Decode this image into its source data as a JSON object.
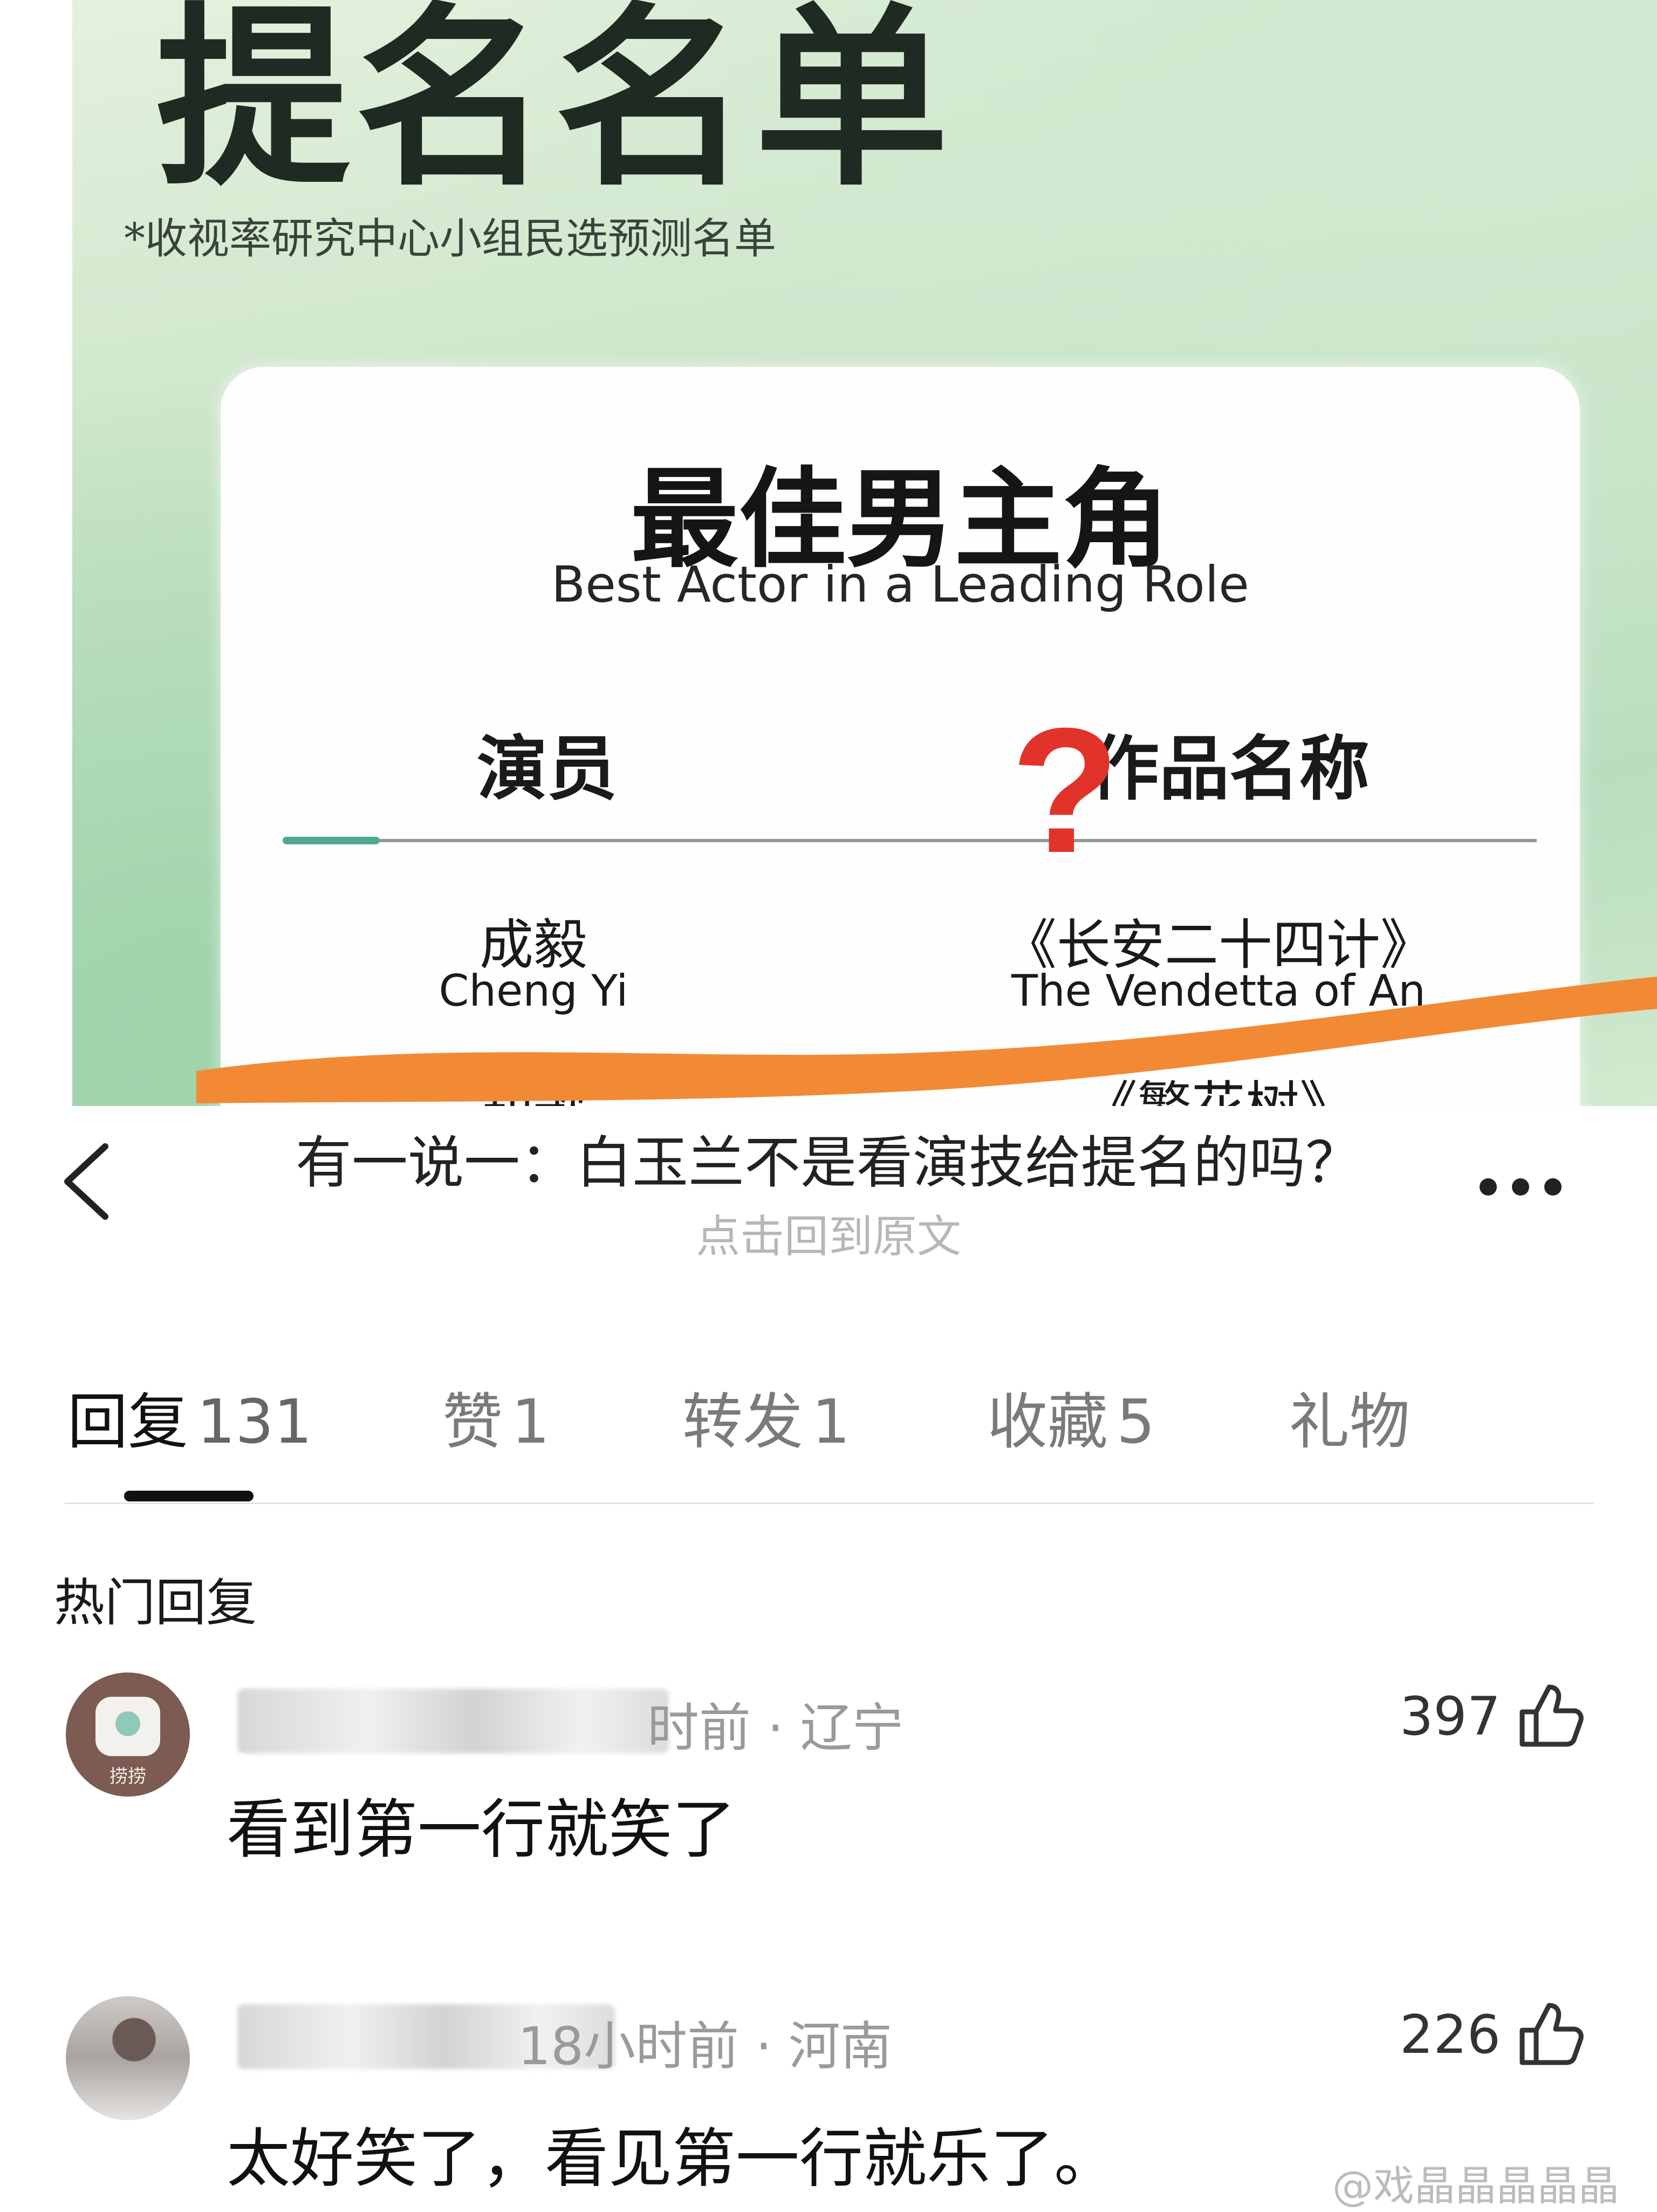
{
  "poster": {
    "title": "提名名单",
    "subtitle": "*收视率研究中心小组民选预测名单",
    "card_title": "最佳男主角",
    "card_subtitle": "Best Actor in a Leading Role",
    "col_actor": "演员",
    "col_work": "作品名称",
    "row1_actor_zh": "成毅",
    "row1_actor_en": "Cheng Yi",
    "row1_work_zh": "《长安二十四计》",
    "row1_work_en": "The Vendetta of An",
    "row2_actor_partial": "胡歌",
    "row2_work_partial": "《繁花树》",
    "question_mark": "?",
    "scribble_color": "#f28a35"
  },
  "nav": {
    "title": "有一说一：白玉兰不是看演技给提名的吗？",
    "subtitle": "点击回到原文"
  },
  "tabs": [
    {
      "label": "回复",
      "count": "131"
    },
    {
      "label": "赞",
      "count": "1"
    },
    {
      "label": "转发",
      "count": "1"
    },
    {
      "label": "收藏",
      "count": "5"
    },
    {
      "label": "礼物",
      "count": ""
    }
  ],
  "section_title": "热门回复",
  "comments": [
    {
      "meta": "时前 · 辽宁",
      "likes": "397",
      "text": "看到第一行就笑了",
      "avatar_label": "捞捞"
    },
    {
      "meta": "18小时前 · 河南",
      "likes": "226",
      "text": "太好笑了，看见第一行就乐了。"
    }
  ],
  "watermark": "@戏晶晶晶晶晶"
}
